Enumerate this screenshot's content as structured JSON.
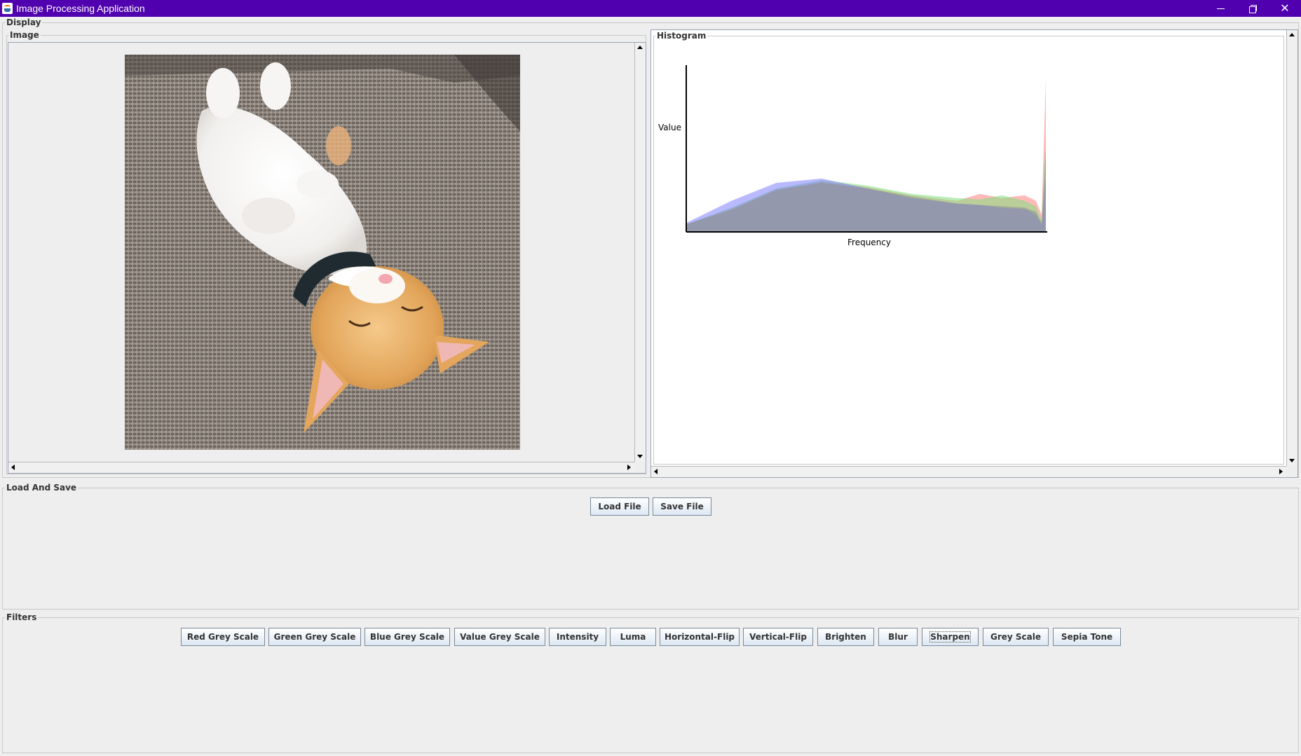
{
  "window": {
    "title": "Image Processing Application",
    "controls": {
      "minimize_icon": "minimize-icon",
      "maximize_icon": "restore-icon",
      "close_icon": "close-icon"
    }
  },
  "display": {
    "label": "Display",
    "image_panel": {
      "label": "Image"
    },
    "histogram_panel": {
      "label": "Histogram",
      "ylabel": "Value",
      "xlabel": "Frequency"
    }
  },
  "load_save": {
    "label": "Load And Save",
    "buttons": [
      "Load File",
      "Save File"
    ]
  },
  "filters": {
    "label": "Filters",
    "buttons": [
      "Red Grey Scale",
      "Green Grey Scale",
      "Blue Grey Scale",
      "Value Grey Scale",
      "Intensity",
      "Luma",
      "Horizontal-Flip",
      "Vertical-Flip",
      "Brighten",
      "Blur",
      "Sharpen",
      "Grey Scale",
      "Sepia Tone"
    ],
    "focused": "Sharpen"
  },
  "chart_data": {
    "type": "area",
    "title": "",
    "xlabel": "Frequency",
    "ylabel": "Value",
    "xlim": [
      0,
      255
    ],
    "series": [
      {
        "color": "#ff8080",
        "x": [
          0,
          32,
          64,
          96,
          128,
          160,
          192,
          208,
          224,
          240,
          248,
          252,
          255
        ],
        "values": [
          5,
          15,
          30,
          36,
          32,
          26,
          22,
          27,
          24,
          26,
          22,
          12,
          110
        ]
      },
      {
        "color": "#80e080",
        "x": [
          0,
          32,
          64,
          96,
          128,
          160,
          192,
          208,
          224,
          240,
          248,
          252,
          255
        ],
        "values": [
          5,
          17,
          31,
          37,
          33,
          27,
          24,
          23,
          26,
          22,
          18,
          8,
          70
        ]
      },
      {
        "color": "#8080ff",
        "x": [
          0,
          32,
          64,
          96,
          128,
          160,
          192,
          208,
          224,
          240,
          248,
          252,
          255
        ],
        "values": [
          6,
          22,
          35,
          38,
          31,
          24,
          20,
          19,
          17,
          16,
          12,
          5,
          40
        ]
      },
      {
        "color": "#909090",
        "x": [
          0,
          32,
          64,
          96,
          128,
          160,
          192,
          208,
          224,
          240,
          248,
          252,
          255
        ],
        "values": [
          5,
          16,
          30,
          35,
          31,
          25,
          20,
          19,
          18,
          17,
          14,
          6,
          60
        ]
      }
    ]
  },
  "colors": {
    "titlebar": "#5000ae",
    "background": "#eeeeee",
    "histogram_bg": "#ffffff",
    "button_border": "#7a8a99"
  }
}
